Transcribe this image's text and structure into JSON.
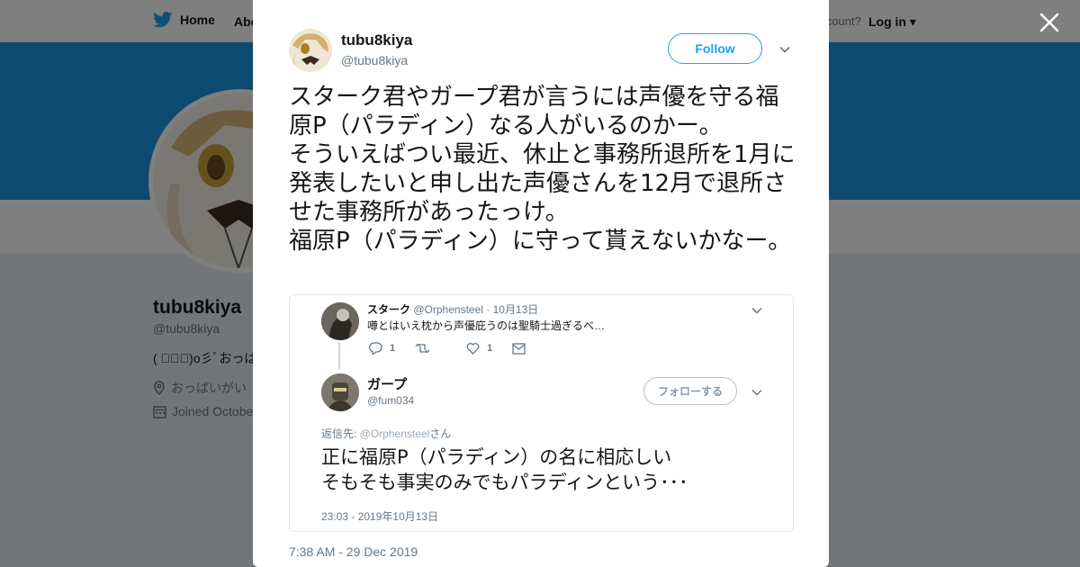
{
  "topbar": {
    "home_label": "Home",
    "about_label": "Abo",
    "account_prompt": "account?",
    "login_label": "Log in"
  },
  "profile": {
    "name": "tubu8kiya",
    "handle": "@tubu8kiya",
    "bio": "(  ﾟ∀ﾟ)o彡ﾟおっぱ",
    "location": "おっぱいがい",
    "joined": "Joined Octobe"
  },
  "tweet": {
    "author_name": "tubu8kiya",
    "author_handle": "@tubu8kiya",
    "follow_label": "Follow",
    "text": "スターク君やガープ君が言うには声優を守る福原P（パラディン）なる人がいるのかー。\nそういえばつい最近、休止と事務所退所を1月に発表したいと申し出た声優さんを12月で退所させた事務所があったっけ。\n福原P（パラディン）に守って貰えないかなー。",
    "timestamp": "7:38 AM - 29 Dec 2019"
  },
  "quoted": {
    "first": {
      "name": "スターク",
      "handle": "@Orphensteel",
      "date": "10月13日",
      "separator": "·",
      "text": "噂とはいえ枕から声優庇うのは聖騎士過ぎるべ…",
      "reply_count": "1",
      "like_count": "1"
    },
    "second": {
      "name": "ガープ",
      "handle": "@fum034",
      "follow_label": "フォローする",
      "reply_prefix": "返信先: ",
      "reply_to": "@Orphensteel",
      "reply_suffix": "さん",
      "text": "正に福原P（パラディン）の名に相応しい\nそもそも事実のみでもパラディンという･･･",
      "timestamp": "23:03 - 2019年10月13日"
    }
  },
  "colors": {
    "brand_blue": "#1da1f2",
    "banner": "#1b95e0",
    "text_primary": "#14171a",
    "text_secondary": "#657786"
  },
  "icons": [
    "twitter-bird-icon",
    "close-icon",
    "chevron-down-icon",
    "reply-icon",
    "retweet-icon",
    "like-icon",
    "message-icon",
    "location-icon",
    "calendar-icon"
  ]
}
